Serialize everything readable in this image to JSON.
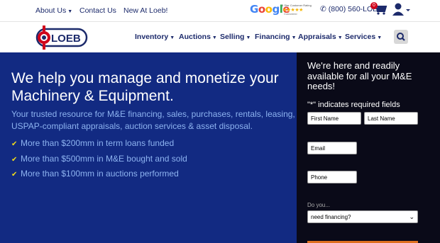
{
  "topbar": {
    "links": [
      "About Us",
      "Contact Us",
      "New At Loeb!"
    ],
    "google": {
      "word": "Google",
      "small_text": "5 Star Customer Rating",
      "stars": "★★★★★",
      "reviews_text": "Guaranteed"
    },
    "phone": "(800) 560-LOEB",
    "cart_count": "0"
  },
  "logo": {
    "text": "LOEB"
  },
  "nav": {
    "items": [
      "Inventory",
      "Auctions",
      "Selling",
      "Financing",
      "Appraisals",
      "Services"
    ]
  },
  "hero": {
    "title": "We help you manage and monetize your Machinery & Equipment.",
    "subtitle": "Your trusted resource for M&E financing, sales, purchases, rentals, leasing, USPAP-compliant appraisals, auction services & asset disposal.",
    "bullets": [
      "More than $200mm in term loans funded",
      "More than $500mm in M&E bought and sold",
      "More than $100mm in auctions performed"
    ]
  },
  "form": {
    "heading": "We're here and readily available for all your M&E needs!",
    "required_note": "\"*\" indicates required fields",
    "first_name_placeholder": "First Name",
    "last_name_placeholder": "Last Name",
    "email_placeholder": "Email",
    "phone_placeholder": "Phone",
    "do_you_label": "Do you...",
    "select_value": "need financing?"
  },
  "colors": {
    "navy": "#1c2a6b",
    "hero_bg": "#122a82",
    "light_blue_text": "#8db3f0",
    "check_yellow": "#f3dd1a",
    "form_bg": "#0a0a18",
    "logo_red": "#d0021b"
  }
}
